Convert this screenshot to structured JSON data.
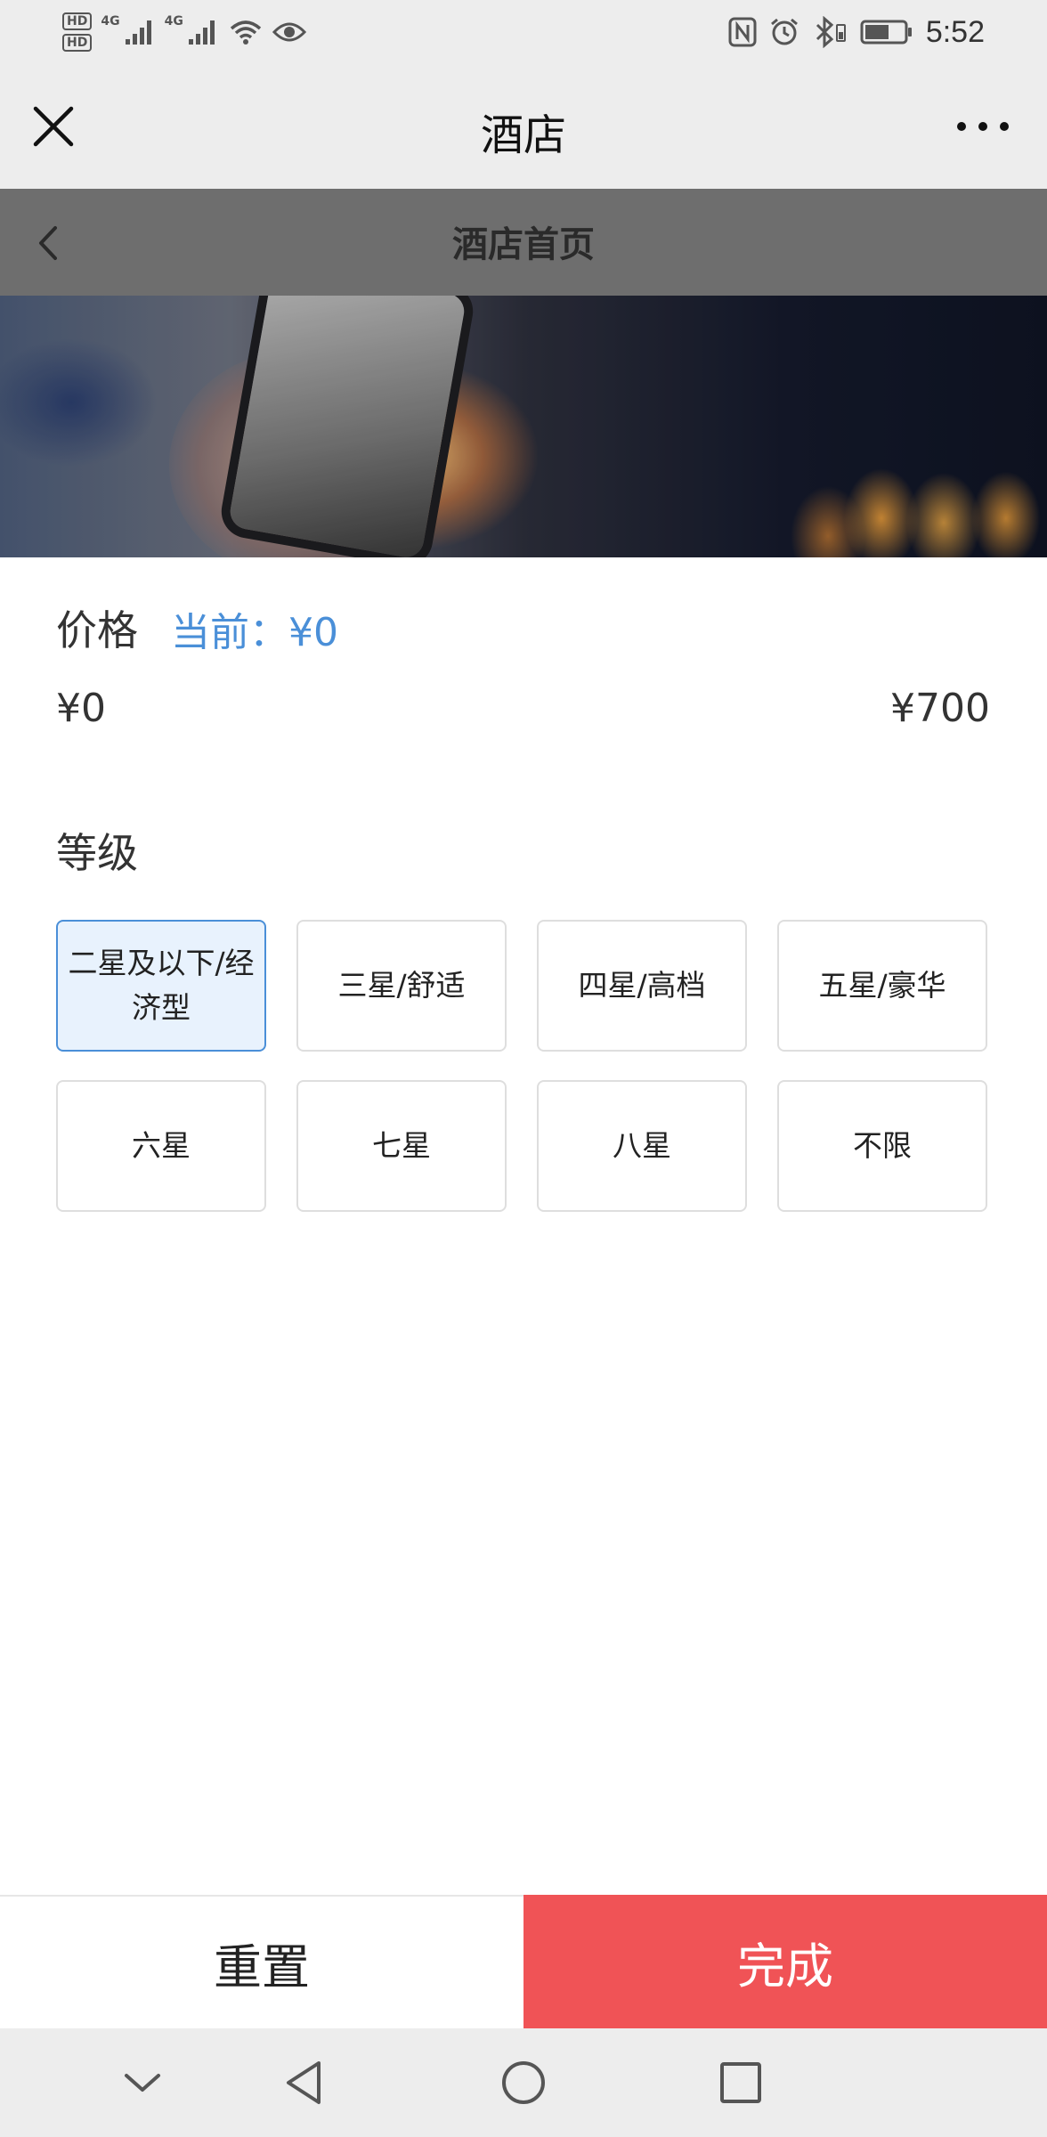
{
  "status_bar": {
    "time": "5:52",
    "hd1": "HD",
    "hd2": "HD",
    "net1": "4G",
    "net2": "4G",
    "icons": [
      "signal-icon",
      "signal-icon",
      "wifi-icon",
      "eye-icon",
      "nfc-icon",
      "alarm-icon",
      "bluetooth-icon",
      "battery-icon"
    ]
  },
  "wechat_bar": {
    "title": "酒店"
  },
  "page_header": {
    "title": "酒店首页"
  },
  "filter": {
    "price_label": "价格",
    "price_current": "当前：¥0",
    "price_min": "¥0",
    "price_max": "¥700",
    "price_current_fraction": 0,
    "level_label": "等级",
    "levels": [
      {
        "label": "二星及以下/经济型",
        "selected": true
      },
      {
        "label": "三星/舒适",
        "selected": false
      },
      {
        "label": "四星/高档",
        "selected": false
      },
      {
        "label": "五星/豪华",
        "selected": false
      },
      {
        "label": "六星",
        "selected": false
      },
      {
        "label": "七星",
        "selected": false
      },
      {
        "label": "八星",
        "selected": false
      },
      {
        "label": "不限",
        "selected": false
      }
    ]
  },
  "actions": {
    "reset_label": "重置",
    "done_label": "完成"
  },
  "colors": {
    "accent": "#4a8fd8",
    "primary_button": "#f05356",
    "selected_bg": "#e8f2fd"
  }
}
